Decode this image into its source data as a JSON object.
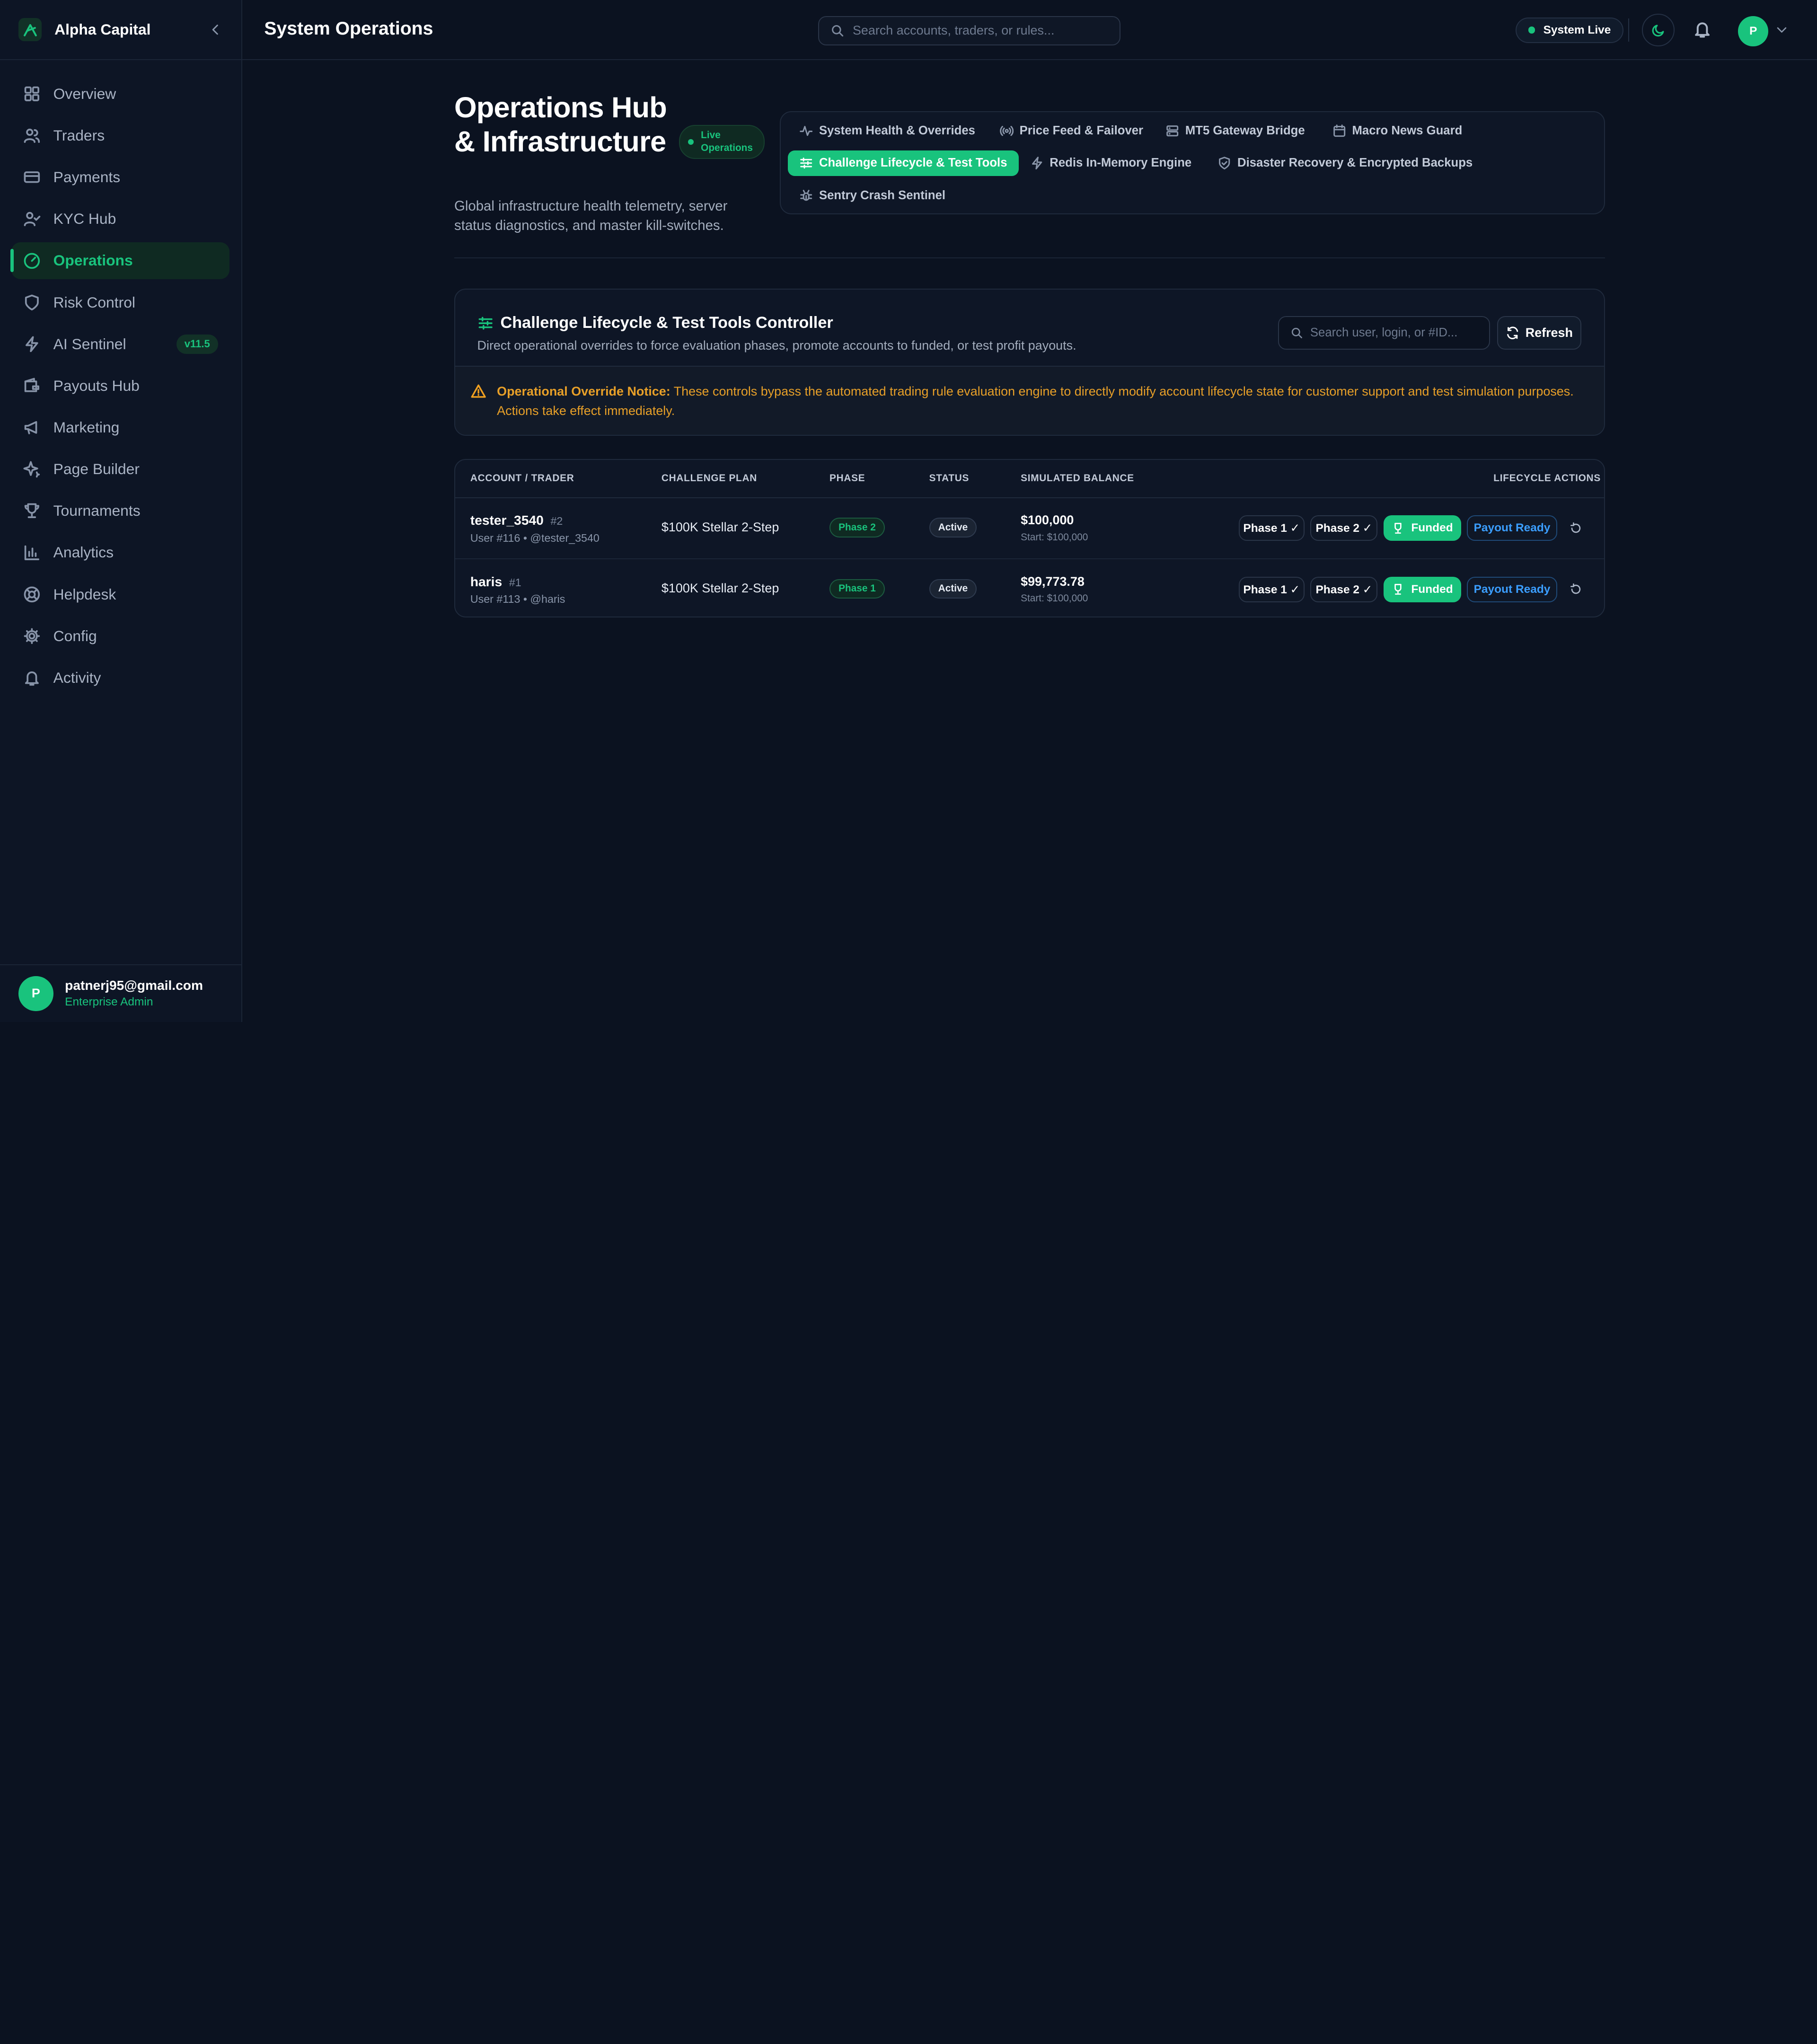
{
  "brand": {
    "name": "Alpha Capital"
  },
  "sidebar": {
    "items": [
      {
        "label": "Overview",
        "icon": "grid-icon"
      },
      {
        "label": "Traders",
        "icon": "users-icon"
      },
      {
        "label": "Payments",
        "icon": "credit-card-icon"
      },
      {
        "label": "KYC Hub",
        "icon": "user-check-icon"
      },
      {
        "label": "Operations",
        "icon": "gauge-icon",
        "active": true
      },
      {
        "label": "Risk Control",
        "icon": "shield-icon"
      },
      {
        "label": "AI Sentinel",
        "icon": "bolt-icon",
        "badge": "v11.5"
      },
      {
        "label": "Payouts Hub",
        "icon": "wallet-icon"
      },
      {
        "label": "Marketing",
        "icon": "megaphone-icon"
      },
      {
        "label": "Page Builder",
        "icon": "sparkle-icon"
      },
      {
        "label": "Tournaments",
        "icon": "trophy-icon"
      },
      {
        "label": "Analytics",
        "icon": "bar-chart-icon"
      },
      {
        "label": "Helpdesk",
        "icon": "lifebuoy-icon"
      },
      {
        "label": "Config",
        "icon": "gear-icon"
      },
      {
        "label": "Activity",
        "icon": "bell-icon"
      }
    ],
    "user": {
      "initial": "P",
      "email": "patnerj95@gmail.com",
      "role": "Enterprise Admin"
    }
  },
  "topbar": {
    "title": "System Operations",
    "search_placeholder": "Search accounts, traders, or rules...",
    "status_label": "System Live",
    "avatar_initial": "P"
  },
  "hero": {
    "title": "Operations Hub & Infrastructure",
    "badge": "Live Operations",
    "subtitle": "Global infrastructure health telemetry, server status diagnostics, and master kill-switches."
  },
  "tabs": [
    {
      "label": "System Health & Overrides",
      "icon": "activity-icon"
    },
    {
      "label": "Price Feed & Failover",
      "icon": "radio-icon"
    },
    {
      "label": "MT5 Gateway Bridge",
      "icon": "server-icon"
    },
    {
      "label": "Macro News Guard",
      "icon": "calendar-icon"
    },
    {
      "label": "Challenge Lifecycle & Test Tools",
      "icon": "sliders-icon",
      "active": true
    },
    {
      "label": "Redis In-Memory Engine",
      "icon": "zap-icon"
    },
    {
      "label": "Disaster Recovery & Encrypted Backups",
      "icon": "shield-check-icon"
    },
    {
      "label": "Sentry Crash Sentinel",
      "icon": "bug-icon"
    }
  ],
  "controller": {
    "title": "Challenge Lifecycle & Test Tools Controller",
    "subtitle": "Direct operational overrides to force evaluation phases, promote accounts to funded, or test profit payouts.",
    "search_placeholder": "Search user, login, or #ID...",
    "refresh_label": "Refresh",
    "notice_title": "Operational Override Notice:",
    "notice_text": "These controls bypass the automated trading rule evaluation engine to directly modify account lifecycle state for customer support and test simulation purposes. Actions take effect immediately."
  },
  "table": {
    "headers": {
      "account": "ACCOUNT / TRADER",
      "plan": "CHALLENGE PLAN",
      "phase": "PHASE",
      "status": "STATUS",
      "balance": "SIMULATED BALANCE",
      "actions": "LIFECYCLE ACTIONS"
    },
    "rows": [
      {
        "name": "tester_3540",
        "num": "#2",
        "meta": "User #116 • @tester_3540",
        "plan": "$100K Stellar 2-Step",
        "phase": "Phase 2",
        "status": "Active",
        "balance": "$100,000",
        "start": "Start: $100,000"
      },
      {
        "name": "haris",
        "num": "#1",
        "meta": "User #113 • @haris",
        "plan": "$100K Stellar 2-Step",
        "phase": "Phase 1",
        "status": "Active",
        "balance": "$99,773.78",
        "start": "Start: $100,000"
      }
    ],
    "actions": {
      "phase1": "Phase 1 ✓",
      "phase2": "Phase 2 ✓",
      "funded": "Funded",
      "payout": "Payout Ready"
    }
  },
  "colors": {
    "accent": "#19c37d",
    "background": "#0b1220",
    "warning": "#e8a028",
    "link": "#3b9eff"
  }
}
